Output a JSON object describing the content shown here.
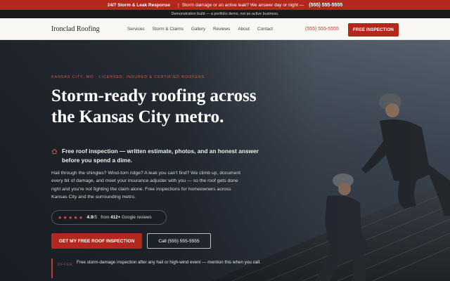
{
  "topbar": {
    "headline": "24/7 Storm & Leak Response",
    "message": "Storm damage or an active leak? We answer day or night —",
    "phone": "(555) 555-5555"
  },
  "demo_notice": "Demonstration build — a portfolio demo, not an active business.",
  "nav": {
    "logo": "Ironclad Roofing",
    "links": [
      "Services",
      "Storm & Claims",
      "Gallery",
      "Reviews",
      "About",
      "Contact"
    ],
    "phone": "(555) 555-5555",
    "cta": "FREE INSPECTION"
  },
  "hero": {
    "eyebrow": "Kansas City, MO · Licensed, Insured & Certified Roofers",
    "headline": "Storm-ready roofing across the Kansas City metro.",
    "bullet": "Free roof inspection — written estimate, photos, and an honest answer before you spend a dime.",
    "body": "Hail through the shingles? Wind-torn ridge? A leak you can't find? We climb up, document every bit of damage, and meet your insurance adjuster with you — so the roof gets done right and you're not fighting the claim alone. Free inspections for homeowners across Kansas City and the surrounding metro.",
    "rating": {
      "stars": "★★★★★",
      "score": "4.9",
      "score_max": "/5",
      "reviews_prefix": "from",
      "reviews_count": "412+",
      "reviews_suffix": "Google reviews"
    },
    "primary_cta": "GET MY FREE ROOF INSPECTION",
    "secondary_cta": "Call (555) 555-5555",
    "offer": {
      "tag": "OFFER",
      "text": "Free storm-damage inspection after any hail or high-wind event — mention this when you call."
    }
  },
  "colors": {
    "accent": "#b3281d",
    "accent_text": "#d65c43",
    "nav_bg": "#faf8f4",
    "demo_bg": "#1b1b1d"
  },
  "icons": {
    "bullet": "house-icon",
    "rating": "star-icon"
  }
}
